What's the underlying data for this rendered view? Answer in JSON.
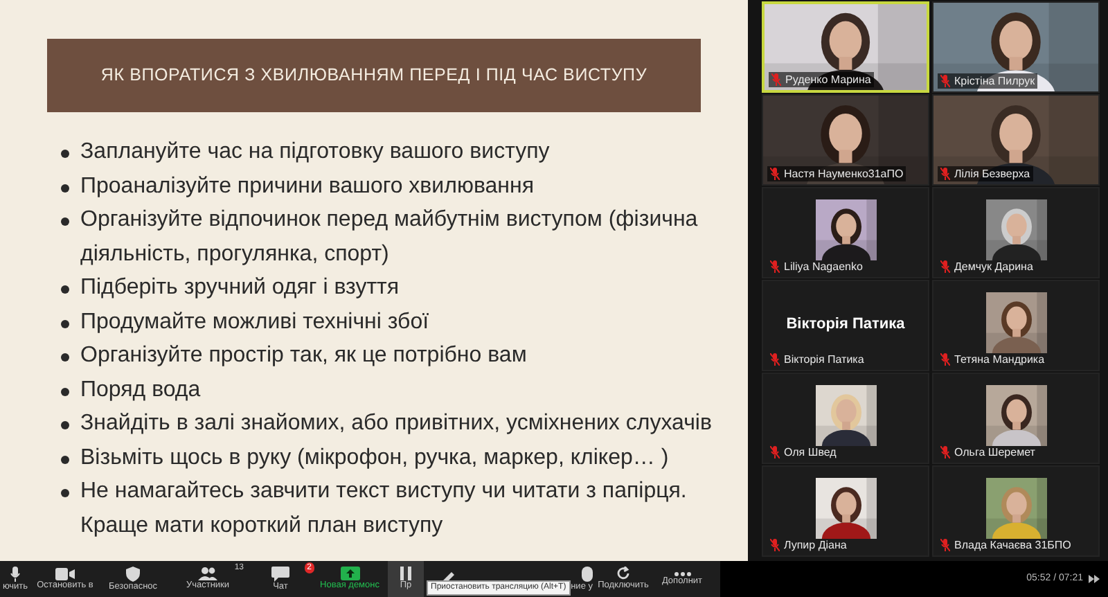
{
  "slide": {
    "title": "ЯК ВПОРАТИСЯ З ХВИЛЮВАННЯМ ПЕРЕД І ПІД ЧАС ВИСТУПУ",
    "bullets": [
      [
        "Заплануйте час на підготовку вашого виступу"
      ],
      [
        "Проаналізуйте причини вашого хвилювання"
      ],
      [
        "Організуйте відпочинок перед майбутнім виступом (фізична",
        "діяльність, прогулянка, спорт)"
      ],
      [
        "Підберіть зручний одяг і взуття"
      ],
      [
        "Продумайте можливі технічні збої"
      ],
      [
        "Організуйте простір так, як це потрібно вам"
      ],
      [
        "Поряд вода"
      ],
      [
        "Знайдіть в залі знайомих, або привітних, усміхнених слухачів"
      ],
      [
        "Візьміть щось в руку (мікрофон, ручка, маркер, клікер… )"
      ],
      [
        "Не намагайтесь завчити текст виступу чи читати з папірця.",
        "Краще мати короткий план виступу"
      ]
    ]
  },
  "participants": [
    {
      "name": "Руденко Марина",
      "kind": "video",
      "speaking": true,
      "muted": true
    },
    {
      "name": "Крістіна Пилрук",
      "kind": "video",
      "speaking": false,
      "muted": true
    },
    {
      "name": "Настя Науменко31аПО",
      "kind": "video",
      "speaking": false,
      "muted": true
    },
    {
      "name": "Лілія Безверха",
      "kind": "video",
      "speaking": false,
      "muted": true
    },
    {
      "name": "Liliya Nagaenko",
      "speaking": false,
      "muted": true
    },
    {
      "name": "Демчук Дарина",
      "speaking": false,
      "muted": true
    },
    {
      "name": "Вікторія Патика",
      "kind": "name",
      "display_name": "Вікторія Патика",
      "speaking": false,
      "muted": true
    },
    {
      "name": "Тетяна Мандрика",
      "speaking": false,
      "muted": true
    },
    {
      "name": "Оля Швед",
      "speaking": false,
      "muted": true
    },
    {
      "name": "Ольга Шеремет",
      "speaking": false,
      "muted": true
    },
    {
      "name": "Лупир Діана",
      "speaking": false,
      "muted": true
    },
    {
      "name": "Влада Качаєва 31БПО",
      "speaking": false,
      "muted": true
    }
  ],
  "toolbar": [
    {
      "kind": "mic",
      "label": "ючить"
    },
    {
      "kind": "video",
      "label": "Остановить в"
    },
    {
      "kind": "shield",
      "label": "Безопаснос"
    },
    {
      "kind": "people",
      "label": "Участники",
      "count": "13"
    },
    {
      "kind": "chat",
      "label": "Чат",
      "badge": "2"
    },
    {
      "kind": "share",
      "label": "Новая демонс"
    },
    {
      "kind": "pause",
      "label": "Пр"
    },
    {
      "kind": "pen"
    },
    {
      "kind": "remote",
      "label": "ние у"
    },
    {
      "kind": "rotate",
      "label": "Подключить"
    },
    {
      "kind": "more",
      "label": "Дополнит"
    }
  ],
  "tooltip": "Приостановить трансляцию (Alt+T)",
  "playback_time": "05:52 / 07:21"
}
